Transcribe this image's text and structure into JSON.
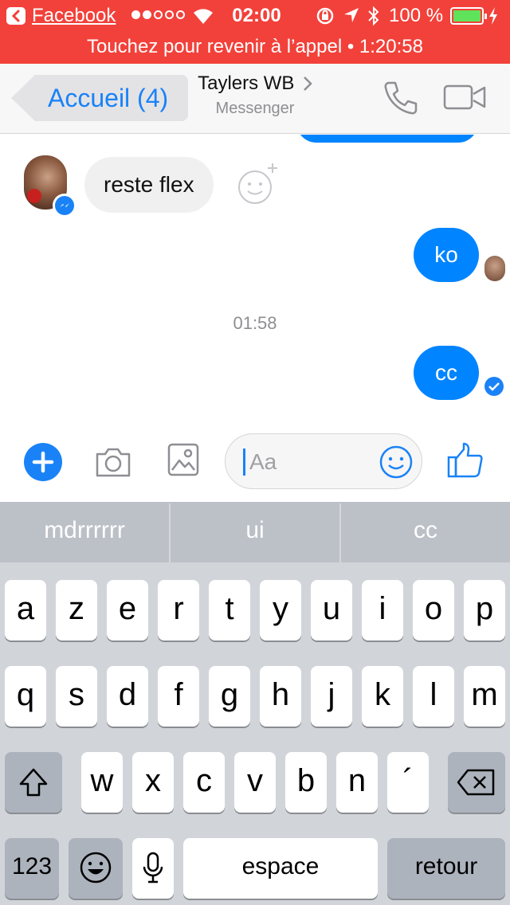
{
  "status_bar": {
    "back_app": "Facebook",
    "time": "02:00",
    "battery": "100 %",
    "call_banner": "Touchez pour revenir à l’appel • 1:20:58"
  },
  "nav": {
    "back_label": "Accueil (4)",
    "contact_name": "Taylers WB",
    "subtitle": "Messenger"
  },
  "messages": {
    "incoming_text": "reste flex",
    "sent_1": "ko",
    "timestamp": "01:58",
    "sent_2": "cc"
  },
  "composer": {
    "placeholder": "Aa"
  },
  "keyboard": {
    "suggestions": [
      "mdrrrrrr",
      "ui",
      "cc"
    ],
    "row1": [
      "a",
      "z",
      "e",
      "r",
      "t",
      "y",
      "u",
      "i",
      "o",
      "p"
    ],
    "row2": [
      "q",
      "s",
      "d",
      "f",
      "g",
      "h",
      "j",
      "k",
      "l",
      "m"
    ],
    "row3": [
      "w",
      "x",
      "c",
      "v",
      "b",
      "n",
      "´"
    ],
    "numbers_label": "123",
    "space_label": "espace",
    "return_label": "retour"
  },
  "colors": {
    "status_red": "#f2413a",
    "messenger_blue": "#0084ff",
    "ios_blue": "#1a82f7"
  },
  "icons": [
    "back-arrow-icon",
    "wifi-icon",
    "rotation-lock-icon",
    "location-icon",
    "bluetooth-icon",
    "battery-icon",
    "chevron-right-icon",
    "phone-icon",
    "video-camera-icon",
    "messenger-badge-icon",
    "add-reaction-icon",
    "delivered-check-icon",
    "plus-icon",
    "camera-icon",
    "gallery-icon",
    "emoji-icon",
    "thumbs-up-icon",
    "shift-icon",
    "backspace-icon",
    "emoji-keyboard-icon",
    "microphone-icon"
  ]
}
